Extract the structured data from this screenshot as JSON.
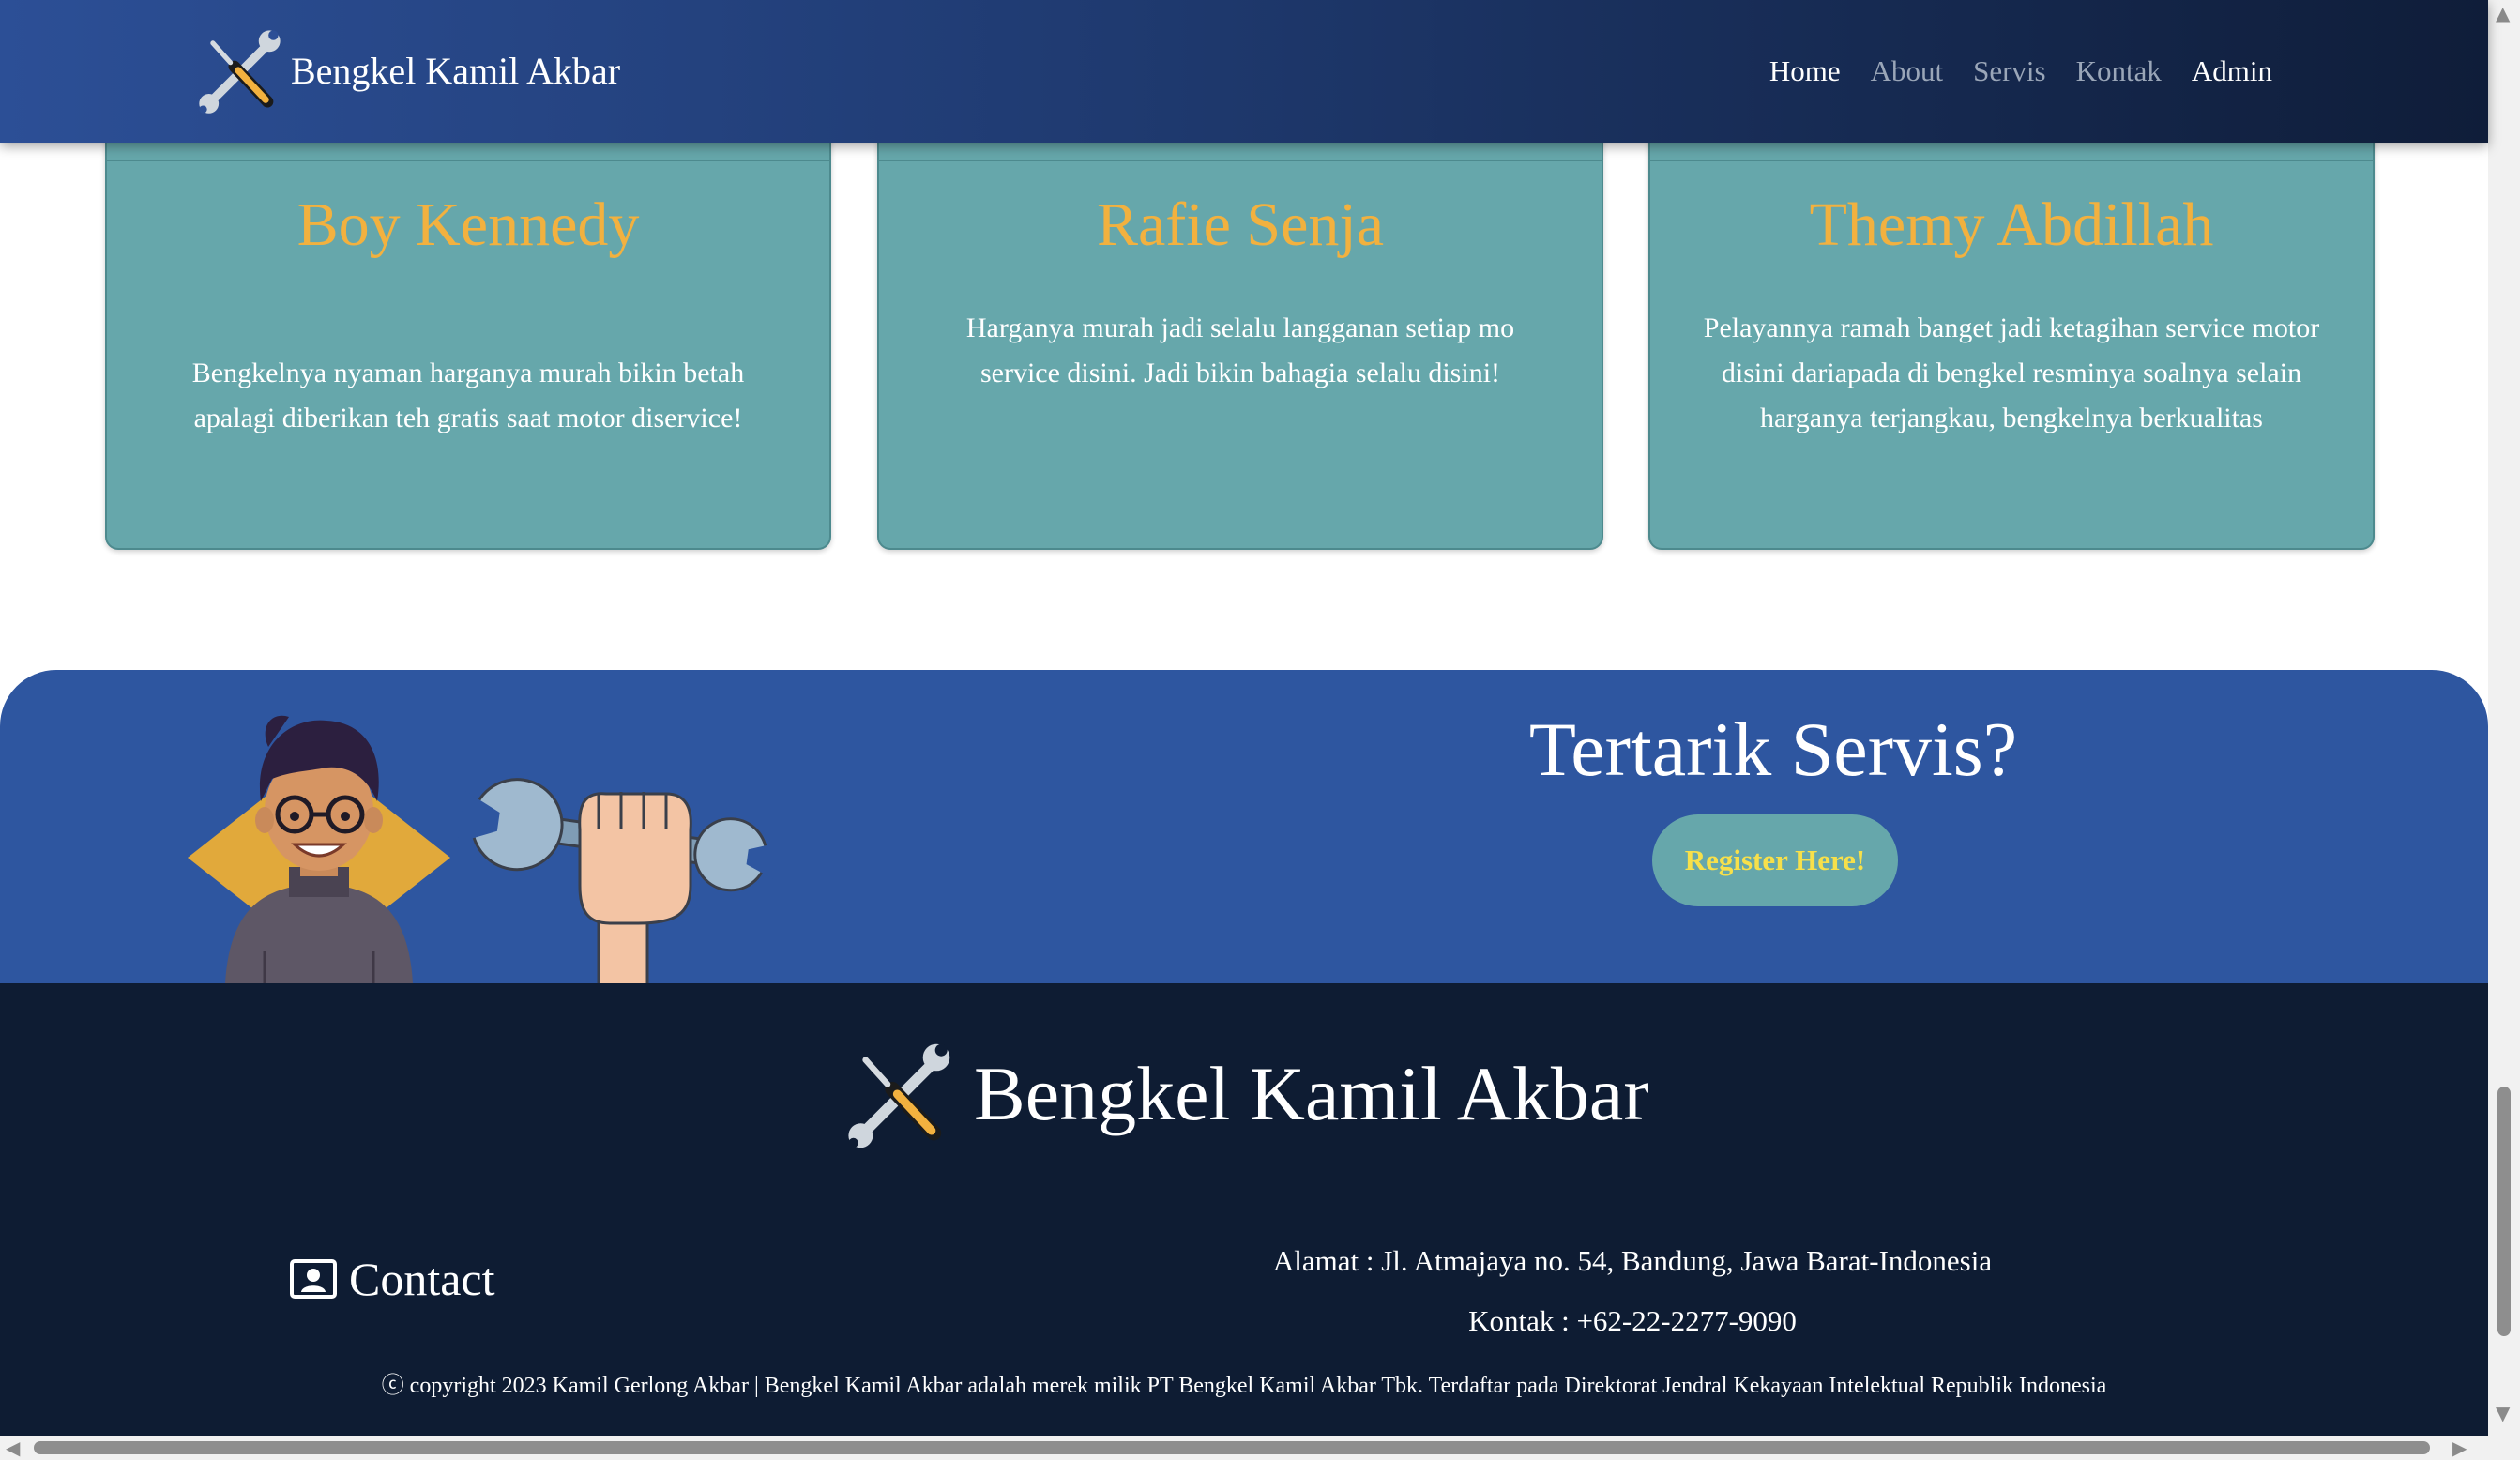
{
  "nav": {
    "brand": "Bengkel Kamil Akbar",
    "logo_icon": "wrench-screwdriver-icon",
    "links": [
      "Home",
      "About",
      "Servis",
      "Kontak",
      "Admin"
    ],
    "colors": {
      "gradient_start": "#2c4f96",
      "gradient_end": "#0f1d39",
      "active": "#ffffff",
      "inactive": "#9aa6b8"
    }
  },
  "testimonials": [
    {
      "name": "Boy Kennedy",
      "text": [
        "Bengkelnya nyaman harganya murah bikin betah",
        "apalagi diberikan teh gratis saat motor diservice!"
      ]
    },
    {
      "name": "Rafie Senja",
      "text": [
        "Harganya murah jadi selalu langganan setiap mo",
        "service disini. Jadi bikin bahagia selalu disini!"
      ]
    },
    {
      "name": "Themy Abdillah",
      "text": [
        "Pelayannya ramah banget jadi ketagihan service motor",
        "disini dariapada di bengkel resminya soalnya selain",
        "harganya terjangkau, bengkelnya berkualitas"
      ]
    }
  ],
  "cta": {
    "title": "Tertarik Servis?",
    "button": "Register Here!",
    "illustration": "mechanic-with-wrench-illustration",
    "colors": {
      "background": "#2e56a0",
      "button_bg": "#66a7ab",
      "button_text": "#f7e04a"
    }
  },
  "footer": {
    "brand": "Bengkel Kamil Akbar",
    "contact_label": "Contact",
    "contact_icon": "contact-card-icon",
    "address": "Alamat : Jl. Atmajaya no. 54, Bandung, Jawa Barat-Indonesia",
    "phone": "Kontak : +62-22-2277-9090",
    "copyright": "ⓒ copyright 2023 Kamil Gerlong Akbar | Bengkel Kamil Akbar adalah merek milik PT Bengkel Kamil Akbar Tbk. Terdaftar pada Direktorat Jendral Kekayaan Intelektual Republik Indonesia",
    "background": "#0e1c33"
  },
  "card_color": "#66a7ab",
  "name_color": "#f2b13f"
}
